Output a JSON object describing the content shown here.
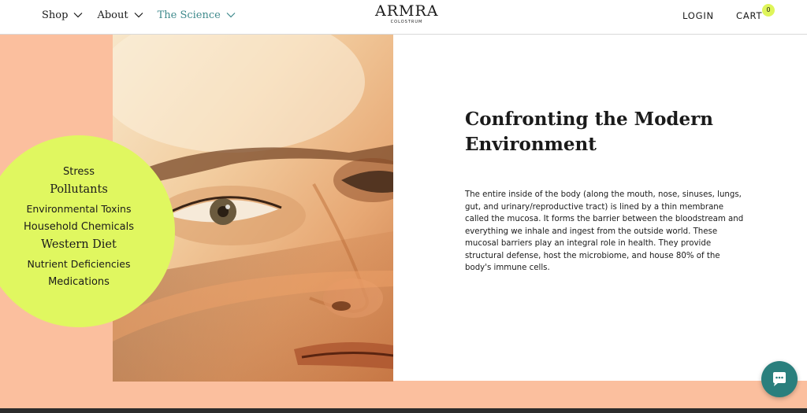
{
  "header": {
    "nav": [
      {
        "label": "Shop",
        "icon": "chevron-down-icon"
      },
      {
        "label": "About",
        "icon": "chevron-down-icon"
      },
      {
        "label": "The Science",
        "icon": "chevron-down-icon",
        "active": true
      }
    ],
    "logo": {
      "word": "ARMRA",
      "sub": "COLOSTRUM"
    },
    "login_label": "LOGIN",
    "cart_label": "CART",
    "cart_count": "0"
  },
  "hero": {
    "photo_icon": "portrait-photo",
    "stressors": [
      "Stress",
      "Pollutants",
      "Environmental Toxins",
      "Household Chemicals",
      "Western Diet",
      "Nutrient Deficiencies",
      "Medications"
    ],
    "heading_line1": "Confronting the Modern",
    "heading_line2": "Environment",
    "body": "The entire inside of the body (along the mouth, nose, sinuses, lungs, gut, and urinary/reproductive tract) is lined by a thin membrane called the mucosa. It forms the barrier between the bloodstream and everything we inhale and ingest from the outside world. These mucosal barriers play an integral role in health. They provide structural defense, host the microbiome, and house 80% of the body's immune cells."
  },
  "chat": {
    "icon": "chat-bubble-icon"
  },
  "colors": {
    "accent_teal": "#3f8a8c",
    "peach": "#fbbf9e",
    "lime": "#e0f760",
    "chat_teal": "#2a7f7d"
  }
}
